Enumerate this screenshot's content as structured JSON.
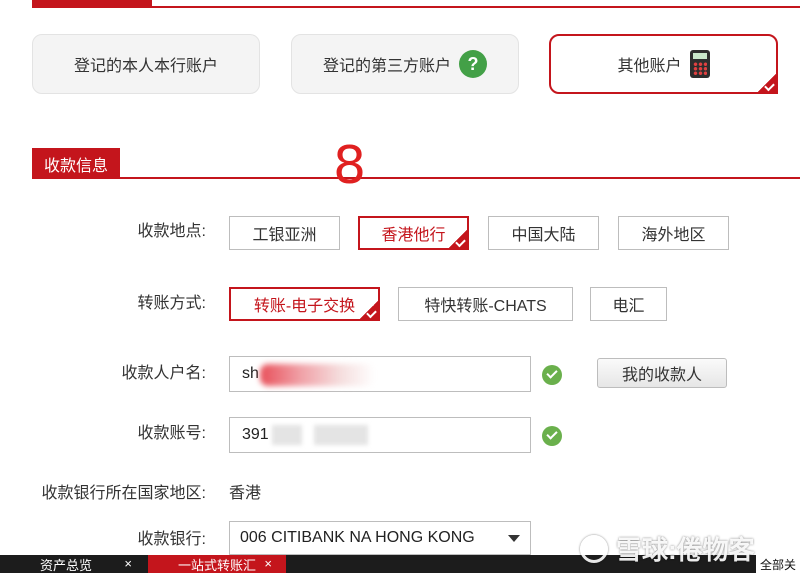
{
  "account_types": [
    {
      "label": "登记的本人本行账户",
      "icon": "",
      "selected": false
    },
    {
      "label": "登记的第三方账户",
      "icon": "help-icon",
      "selected": false
    },
    {
      "label": "其他账户",
      "icon": "calculator-icon",
      "selected": true
    }
  ],
  "help_icon_glyph": "?",
  "section": {
    "title": "收款信息"
  },
  "overlay_digit": "8",
  "form": {
    "location": {
      "label": "收款地点:",
      "options": [
        "工银亚洲",
        "香港他行",
        "中国大陆",
        "海外地区"
      ],
      "selected": "香港他行"
    },
    "method": {
      "label": "转账方式:",
      "options": [
        "转账-电子交换",
        "特快转账-CHATS",
        "电汇"
      ],
      "selected": "转账-电子交换"
    },
    "payee_name": {
      "label": "收款人户名:",
      "value": "sh",
      "my_payees_button": "我的收款人"
    },
    "account_no": {
      "label": "收款账号:",
      "value": "391"
    },
    "bank_country": {
      "label": "收款银行所在国家地区:",
      "value": "香港"
    },
    "bank": {
      "label": "收款银行:",
      "value": "006 CITIBANK NA HONG KONG"
    }
  },
  "taskbar": {
    "tabs": [
      {
        "label": "资产总览",
        "close": "×",
        "active": false
      },
      {
        "label": "一站式转账汇",
        "close": "×",
        "active": true
      }
    ],
    "right_label": "全部关"
  },
  "watermark": {
    "text": "雪球:倦物客"
  },
  "colors": {
    "accent": "#c4151c",
    "success": "#6ab04c",
    "help": "#43a047"
  }
}
